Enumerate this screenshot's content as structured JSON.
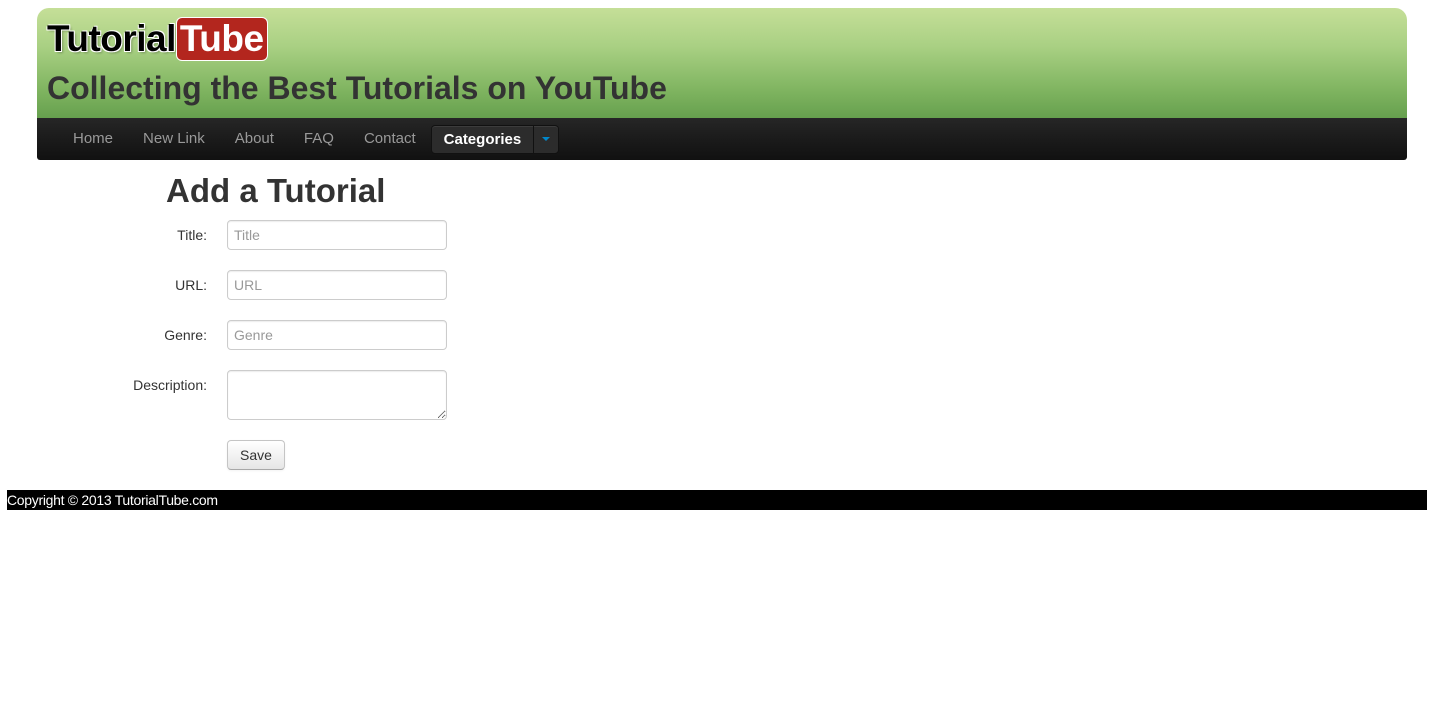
{
  "header": {
    "logo_part1": "Tutorial",
    "logo_part2": "Tube",
    "tagline": "Collecting the Best Tutorials on YouTube"
  },
  "nav": {
    "items": [
      "Home",
      "New Link",
      "About",
      "FAQ",
      "Contact"
    ],
    "dropdown_label": "Categories"
  },
  "main": {
    "title": "Add a Tutorial",
    "fields": {
      "title": {
        "label": "Title:",
        "placeholder": "Title",
        "value": ""
      },
      "url": {
        "label": "URL:",
        "placeholder": "URL",
        "value": ""
      },
      "genre": {
        "label": "Genre:",
        "placeholder": "Genre",
        "value": ""
      },
      "description": {
        "label": "Description:",
        "value": ""
      }
    },
    "save_label": "Save"
  },
  "footer": {
    "copyright": "Copyright © 2013 TutorialTube.com"
  },
  "colors": {
    "header_top": "#c5df98",
    "header_bottom": "#66a04e",
    "navbar": "#1b1b1b",
    "logo_tube_bg": "#b3261e",
    "caret": "#0088cc",
    "footer_bg": "#000000"
  },
  "icons": {
    "dropdown_caret": "caret-down-icon"
  }
}
